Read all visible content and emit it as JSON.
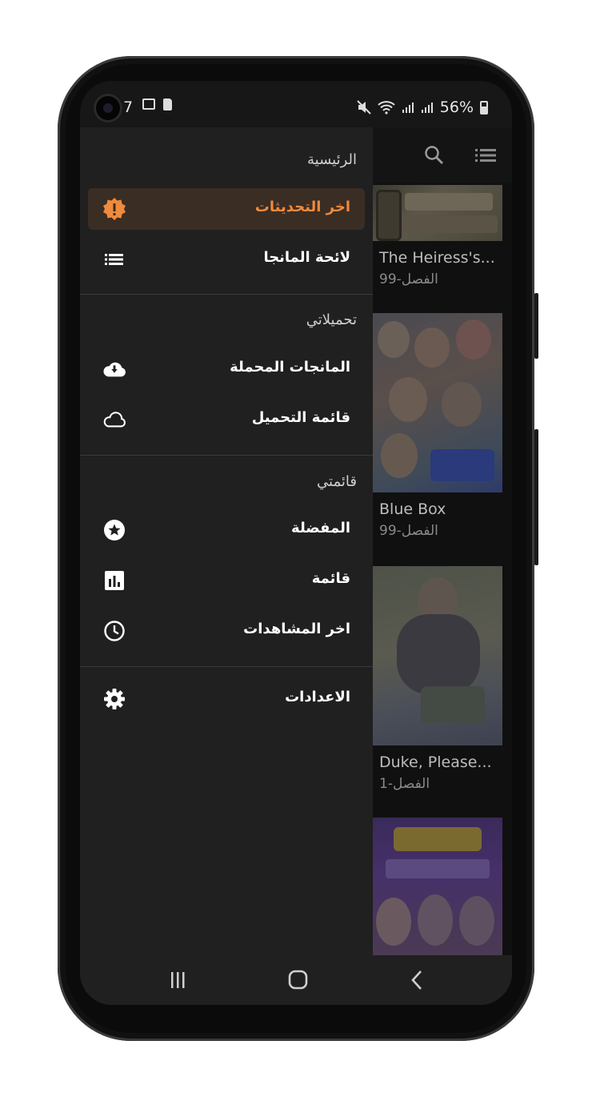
{
  "status_bar": {
    "time": "7",
    "battery": "56%"
  },
  "drawer": {
    "home_label": "الرئيسية",
    "items_top": [
      {
        "label": "اخر التحديثات",
        "icon": "update-badge-icon",
        "active": true
      },
      {
        "label": "لائحة المانجا",
        "icon": "list-icon",
        "active": false
      }
    ],
    "downloads_section": "تحميلاتي",
    "downloads_items": [
      {
        "label": "المانجات المحملة",
        "icon": "cloud-download-icon"
      },
      {
        "label": "قائمة التحميل",
        "icon": "cloud-icon"
      }
    ],
    "my_list_section": "قائمتي",
    "my_list_items": [
      {
        "label": "المفضلة",
        "icon": "star-icon"
      },
      {
        "label": "قائمة",
        "icon": "chart-icon"
      },
      {
        "label": "اخر المشاهدات",
        "icon": "clock-icon"
      }
    ],
    "settings_label": "الاعدادات",
    "accent_color": "#f08a3c"
  },
  "background_list": {
    "cards": [
      {
        "title": "The Heiress's...",
        "chapter": "الفصل-99"
      },
      {
        "title": "Blue Box",
        "chapter": "الفصل-99"
      },
      {
        "title": "Duke, Please...",
        "chapter": "الفصل-1"
      },
      {
        "title": "",
        "chapter": ""
      }
    ]
  },
  "nav_bar": {
    "recents": "recents-icon",
    "home": "home-icon",
    "back": "back-icon"
  }
}
